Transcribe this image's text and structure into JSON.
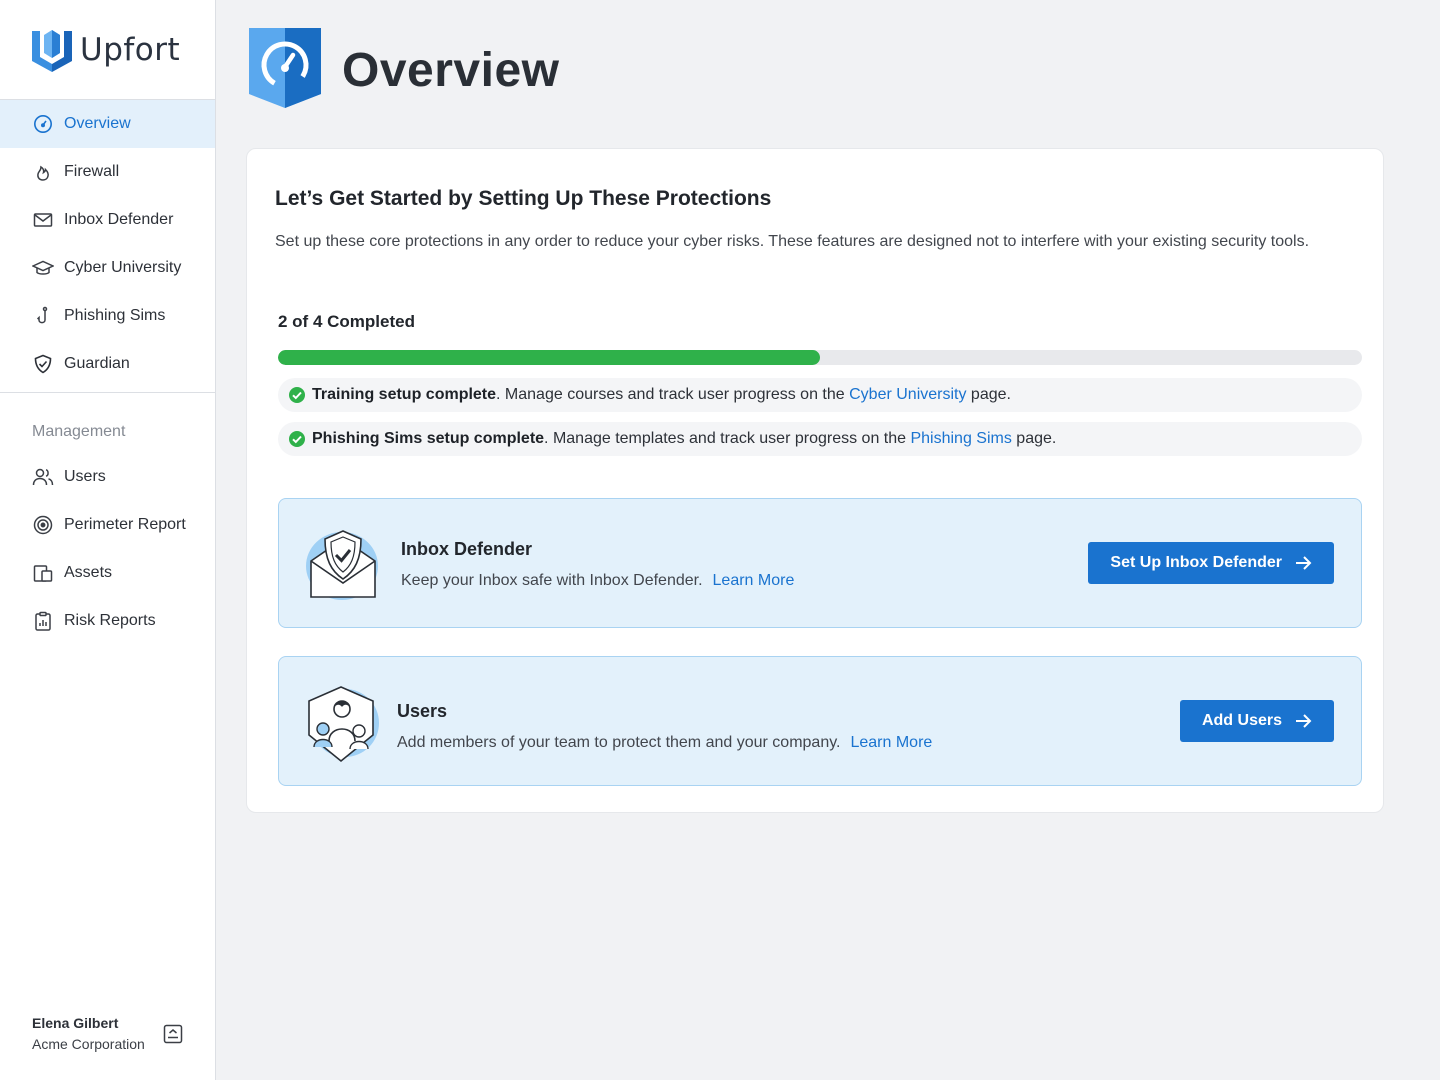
{
  "brand": {
    "name": "Upfort",
    "accent": "#1a73cf",
    "success": "#2fb14a"
  },
  "sidebar": {
    "primary": [
      {
        "label": "Overview",
        "icon": "gauge-icon",
        "active": true
      },
      {
        "label": "Firewall",
        "icon": "flame-icon"
      },
      {
        "label": "Inbox Defender",
        "icon": "mail-icon"
      },
      {
        "label": "Cyber University",
        "icon": "graduation-cap-icon"
      },
      {
        "label": "Phishing Sims",
        "icon": "fishing-hook-icon"
      },
      {
        "label": "Guardian",
        "icon": "shield-check-icon"
      }
    ],
    "management_heading": "Management",
    "management": [
      {
        "label": "Users",
        "icon": "users-icon"
      },
      {
        "label": "Perimeter Report",
        "icon": "target-icon"
      },
      {
        "label": "Assets",
        "icon": "assets-icon"
      },
      {
        "label": "Risk Reports",
        "icon": "clipboard-chart-icon"
      }
    ],
    "user": {
      "name": "Elena Gilbert",
      "org": "Acme Corporation",
      "menu_icon": "expand-menu-icon"
    }
  },
  "header": {
    "title": "Overview",
    "icon": "gauge-shield-icon"
  },
  "setup": {
    "title": "Let’s Get Started by Setting Up These Protections",
    "description": "Set up these core protections in any order to reduce your cyber risks. These features are designed not to interfere with your existing security tools.",
    "progress": {
      "label": "2 of 4 Completed",
      "completed": 2,
      "total": 4
    },
    "completed_items": [
      {
        "bold": "Training setup complete",
        "text": ". Manage courses and track user progress on the ",
        "link": "Cyber University",
        "suffix": " page."
      },
      {
        "bold": "Phishing Sims setup complete",
        "text": ". Manage templates and track user progress on the ",
        "link": "Phishing Sims",
        "suffix": " page."
      }
    ],
    "features": [
      {
        "title": "Inbox Defender",
        "description": "Keep your Inbox safe with Inbox Defender.",
        "link": "Learn More",
        "button": "Set Up Inbox Defender",
        "illustration": "envelope-shield-illustration"
      },
      {
        "title": "Users",
        "description": "Add members of your team to protect them and your company.",
        "link": "Learn More",
        "button": "Add Users",
        "illustration": "users-shield-illustration"
      }
    ]
  }
}
